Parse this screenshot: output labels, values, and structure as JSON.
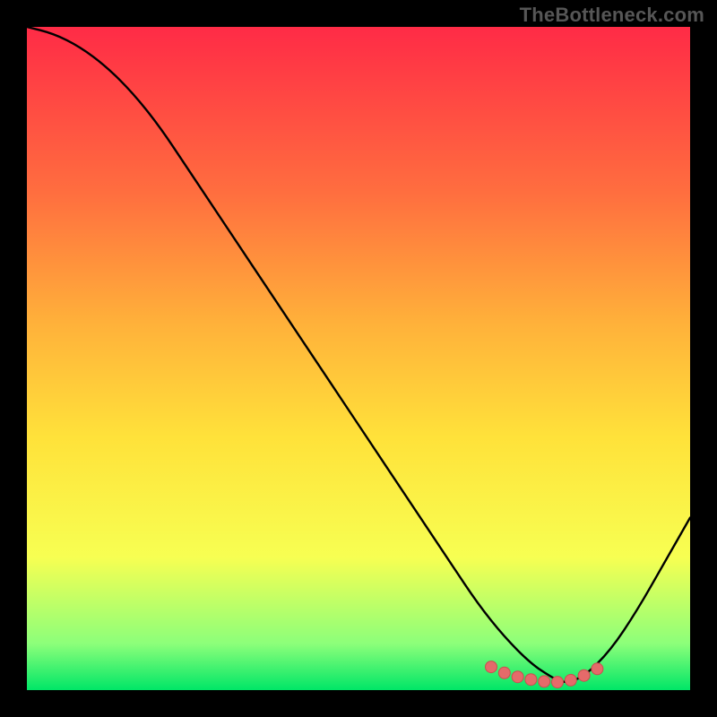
{
  "watermark": "TheBottleneck.com",
  "colors": {
    "bg_black": "#000000",
    "grad_top": "#FF2B46",
    "grad_mid1": "#FF6E3F",
    "grad_mid2": "#FFB23A",
    "grad_mid3": "#FFE23A",
    "grad_low1": "#F7FF52",
    "grad_low2": "#8CFF7A",
    "grad_bottom": "#00E667",
    "curve": "#000000",
    "marker_fill": "#E56A6A",
    "marker_stroke": "#C94F4F"
  },
  "chart_data": {
    "type": "line",
    "title": "",
    "xlabel": "",
    "ylabel": "",
    "xlim": [
      0,
      100
    ],
    "ylim": [
      0,
      100
    ],
    "series": [
      {
        "name": "bottleneck-curve",
        "x": [
          0,
          4,
          8,
          12,
          16,
          20,
          24,
          28,
          32,
          36,
          40,
          44,
          48,
          52,
          56,
          60,
          64,
          68,
          72,
          76,
          79,
          81,
          84,
          88,
          92,
          96,
          100
        ],
        "y": [
          100,
          99,
          97,
          94,
          90,
          85,
          79,
          73,
          67,
          61,
          55,
          49,
          43,
          37,
          31,
          25,
          19,
          13,
          8,
          4,
          2,
          1,
          2,
          6,
          12,
          19,
          26
        ]
      }
    ],
    "markers": {
      "name": "optimal-range",
      "x": [
        70,
        72,
        74,
        76,
        78,
        80,
        82,
        84,
        86
      ],
      "y": [
        3.5,
        2.6,
        2.0,
        1.6,
        1.3,
        1.2,
        1.5,
        2.2,
        3.2
      ]
    }
  }
}
